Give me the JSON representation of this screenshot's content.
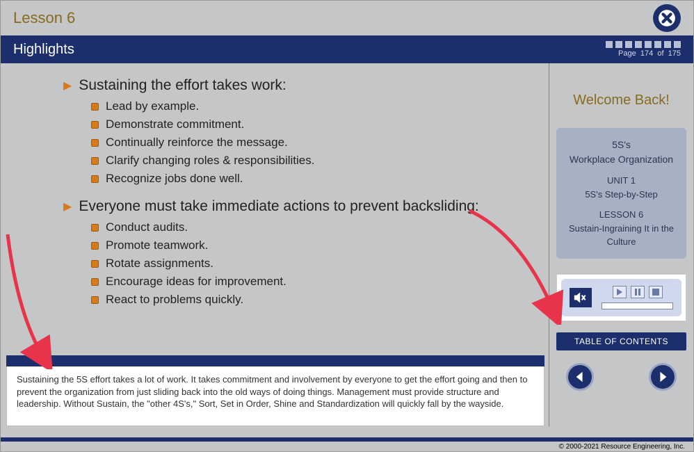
{
  "header": {
    "lesson_title": "Lesson 6",
    "highlights_label": "Highlights",
    "page_indicator_prefix": "Page",
    "page_current": "174",
    "page_of": "of",
    "page_total": "175"
  },
  "content": {
    "sections": [
      {
        "heading": "Sustaining the effort takes work:",
        "items": [
          "Lead by example.",
          "Demonstrate commitment.",
          "Continually reinforce the message.",
          "Clarify changing roles & responsibilities.",
          "Recognize jobs done well."
        ]
      },
      {
        "heading": "Everyone must take immediate actions to prevent backsliding:",
        "items": [
          "Conduct audits.",
          "Promote teamwork.",
          "Rotate assignments.",
          "Encourage ideas for improvement.",
          "React to problems quickly."
        ]
      }
    ]
  },
  "transcript": "Sustaining the 5S effort takes a lot of work. It takes commitment and involvement by everyone to get the effort going and then to prevent the organization from just sliding back into the old ways of doing things. Management must provide structure and leadership. Without Sustain, the \"other 4S's,\" Sort, Set in Order, Shine and Standardization will quickly fall by the wayside.",
  "sidebar": {
    "welcome": "Welcome Back!",
    "card": {
      "course_title1": "5S's",
      "course_title2": "Workplace Organization",
      "unit_label": "UNIT 1",
      "unit_title": "5S's Step-by-Step",
      "lesson_label": "LESSON 6",
      "lesson_title": "Sustain-Ingraining It in the Culture"
    },
    "toc_label": "TABLE OF CONTENTS"
  },
  "footer": {
    "copyright": "© 2000-2021 Resource Engineering, Inc."
  }
}
